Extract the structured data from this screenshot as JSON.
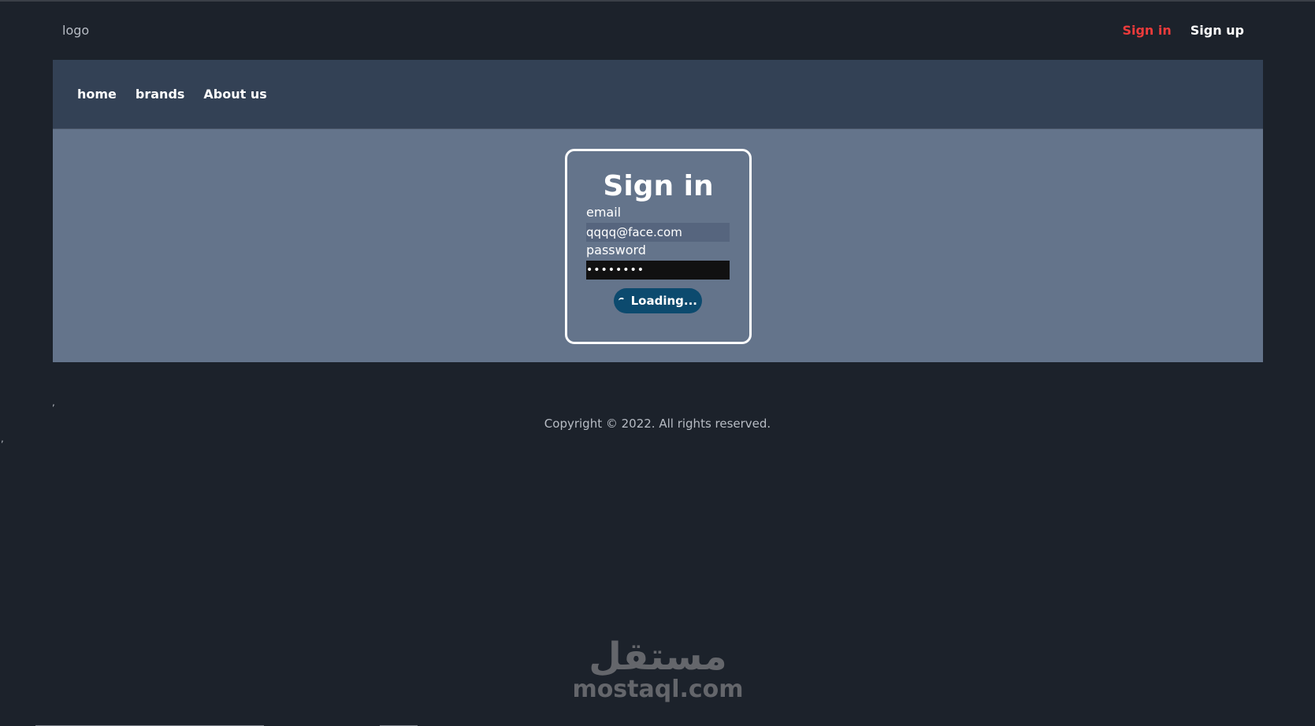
{
  "header": {
    "logo": "logo",
    "signin_label": "Sign in",
    "signup_label": "Sign up"
  },
  "nav": {
    "items": [
      {
        "label": "home"
      },
      {
        "label": "brands"
      },
      {
        "label": "About us"
      }
    ]
  },
  "signin_form": {
    "title": "Sign in",
    "email_label": "email",
    "email_value": "qqqq@face.com",
    "password_label": "password",
    "password_value": "••••••••",
    "submit_label": "Loading..."
  },
  "footer": {
    "copyright": "Copyright © 2022. All rights reserved."
  },
  "watermark": {
    "arabic": "مستقل",
    "latin": "mostaql.com"
  },
  "colors": {
    "background": "#1c222b",
    "navbar": "#334155",
    "content": "#64748b",
    "accent_red": "#ec3b3b",
    "button": "#0c4a6e"
  }
}
